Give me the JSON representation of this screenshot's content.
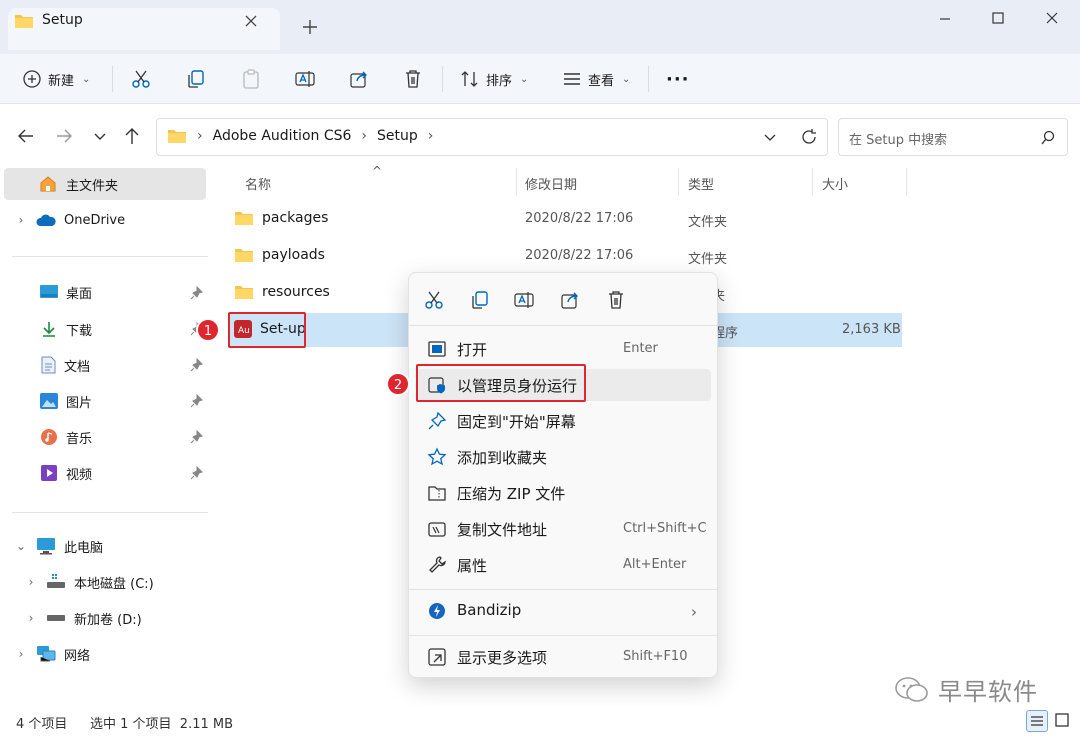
{
  "window": {
    "tab_title": "Setup",
    "new_tab_label": "+"
  },
  "toolbar": {
    "new_label": "新建",
    "sort_label": "排序",
    "view_label": "查看",
    "more_label": "···"
  },
  "address": {
    "crumbs": [
      "Adobe Audition CS6",
      "Setup"
    ],
    "search_placeholder": "在 Setup 中搜索"
  },
  "sidebar": {
    "home": "主文件夹",
    "onedrive": "OneDrive",
    "quick": [
      "桌面",
      "下载",
      "文档",
      "图片",
      "音乐",
      "视频"
    ],
    "this_pc": "此电脑",
    "drives": [
      "本地磁盘 (C:)",
      "新加卷 (D:)"
    ],
    "network": "网络"
  },
  "columns": {
    "name": "名称",
    "modified": "修改日期",
    "type": "类型",
    "size": "大小"
  },
  "files": [
    {
      "name": "packages",
      "modified": "2020/8/22 17:06",
      "type": "文件夹",
      "size": ""
    },
    {
      "name": "payloads",
      "modified": "2020/8/22 17:06",
      "type": "文件夹",
      "size": ""
    },
    {
      "name": "resources",
      "modified": "",
      "type": "夹",
      "size": ""
    },
    {
      "name": "Set-up",
      "modified": "",
      "type": "程序",
      "size": "2,163 KB"
    }
  ],
  "context_menu": {
    "items": [
      {
        "label": "打开",
        "key": "Enter"
      },
      {
        "label": "以管理员身份运行",
        "key": ""
      },
      {
        "label": "固定到\"开始\"屏幕",
        "key": ""
      },
      {
        "label": "添加到收藏夹",
        "key": ""
      },
      {
        "label": "压缩为 ZIP 文件",
        "key": ""
      },
      {
        "label": "复制文件地址",
        "key": "Ctrl+Shift+C"
      },
      {
        "label": "属性",
        "key": "Alt+Enter"
      },
      {
        "label": "Bandizip",
        "key": "›"
      },
      {
        "label": "显示更多选项",
        "key": "Shift+F10"
      }
    ]
  },
  "annotations": {
    "badge_1": "1",
    "badge_2": "2"
  },
  "status": {
    "count": "4 个项目",
    "selection": "选中 1 个项目  2.11 MB"
  },
  "watermark": "早早软件",
  "colors": {
    "accent": "#0067c0",
    "folder": "#f4c44e",
    "highlight_red": "#e0262d"
  }
}
